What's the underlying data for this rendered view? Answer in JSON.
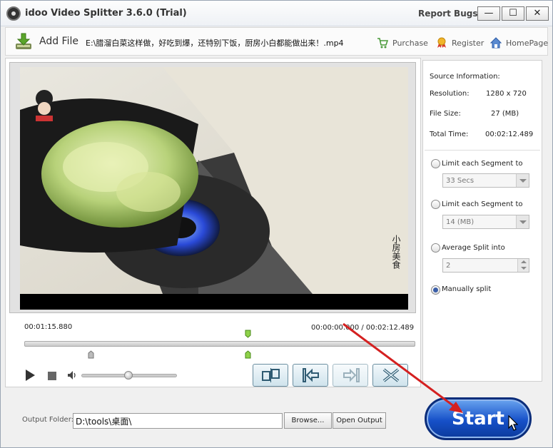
{
  "window": {
    "title": "idoo Video Splitter 3.6.0 (Trial)",
    "report_bugs": "Report Bugs",
    "minimize": "—",
    "maximize": "☐",
    "close": "✕"
  },
  "toolbar": {
    "add_file": "Add File",
    "file_path": "E:\\腊溜白菜这样做，好吃到爆，还特别下饭，厨房小白都能做出来！.mp4",
    "purchase": "Purchase",
    "register": "Register",
    "homepage": "HomePage"
  },
  "player": {
    "current_time": "00:01:15.880",
    "position_total": "00:00:00.000 / 00:02:12.489",
    "volume_fraction": 0.5,
    "timeline_marker_fraction": 0.57
  },
  "source_info": {
    "heading": "Source Information:",
    "resolution_label": "Resolution:",
    "resolution_value": "1280 x 720",
    "filesize_label": "File Size:",
    "filesize_value": "27 (MB)",
    "totaltime_label": "Total Time:",
    "totaltime_value": "00:02:12.489"
  },
  "split_options": {
    "opt_time_label": "Limit each Segment to",
    "opt_time_value": "33 Secs",
    "opt_size_label": "Limit each Segment to",
    "opt_size_value": "14 (MB)",
    "opt_avg_label": "Average Split into",
    "opt_avg_value": "2",
    "opt_manual_label": "Manually split",
    "selected": "manual"
  },
  "output": {
    "label": "Output Folder:",
    "path": "D:\\tools\\桌面\\",
    "browse": "Browse...",
    "open_output": "Open Output"
  },
  "start": {
    "label": "Start"
  },
  "colors": {
    "accent_blue": "#1650c8",
    "annotation_arrow": "#d42020",
    "timeline_marker": "#7cc23a"
  }
}
